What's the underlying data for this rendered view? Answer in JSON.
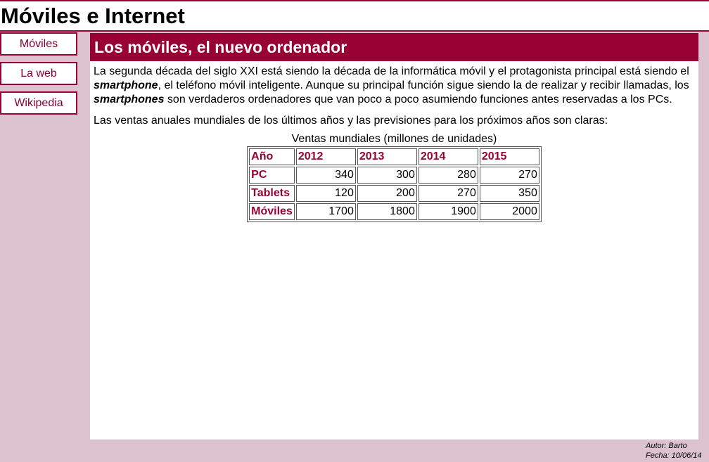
{
  "site": {
    "title": "Móviles e Internet"
  },
  "nav": {
    "items": [
      {
        "label": "Móviles"
      },
      {
        "label": "La web"
      },
      {
        "label": "Wikipedia"
      }
    ]
  },
  "article": {
    "heading": "Los móviles, el nuevo ordenador",
    "p1": {
      "part1": "La segunda década del siglo XXI está siendo la década de la informática móvil y el protagonista principal está siendo el ",
      "em1": "smartphone",
      "part2": ", el teléfono móvil inteligente. Aunque su principal función sigue siendo la de realizar y recibir llamadas, los ",
      "em2": "smartphones",
      "part3": " son verdaderos ordenadores que van poco a poco asumiendo funciones antes reservadas a los PCs."
    },
    "p2": "Las ventas anuales mundiales de los últimos años y las previsiones para los próximos años son claras:"
  },
  "table": {
    "caption": "Ventas mundiales (millones de unidades)",
    "header": [
      "Año",
      "2012",
      "2013",
      "2014",
      "2015"
    ],
    "rows": [
      {
        "label": "PC",
        "values": [
          "340",
          "300",
          "280",
          "270"
        ]
      },
      {
        "label": "Tablets",
        "values": [
          "120",
          "200",
          "270",
          "350"
        ]
      },
      {
        "label": "Móviles",
        "values": [
          "1700",
          "1800",
          "1900",
          "2000"
        ]
      }
    ]
  },
  "footer": {
    "author": "Autor: Barto",
    "date": "Fecha: 10/06/14"
  },
  "colors": {
    "accent": "#990033",
    "page_background": "#dcc3cf",
    "content_background": "#ffffff"
  }
}
